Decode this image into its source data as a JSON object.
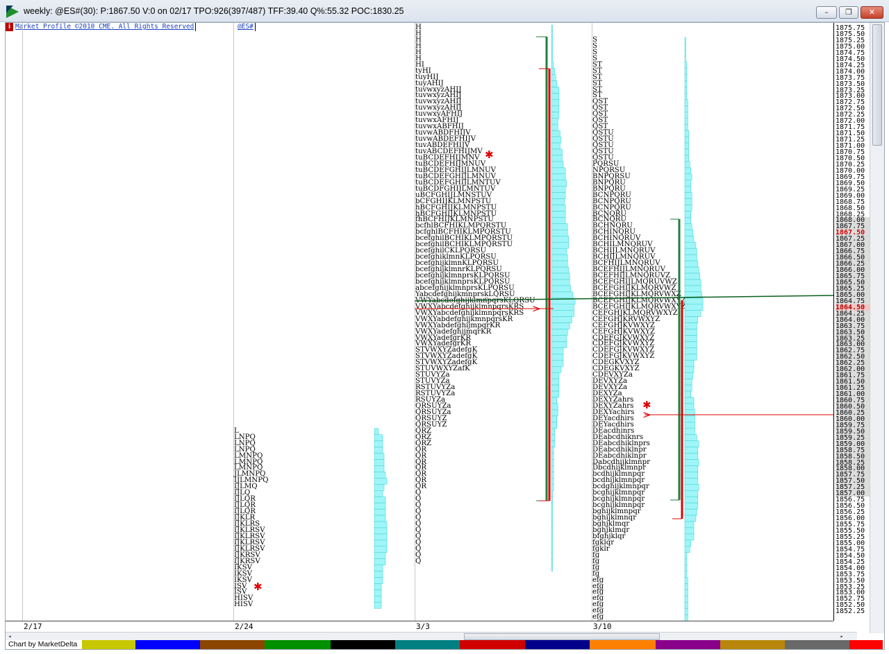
{
  "window": {
    "title": "weekly: @ES#(30): P:1867.50 V:0 on 02/17 TPO:926(397/487) TFF:39.40 Q%:55.32 POC:1830.25",
    "minimize": "–",
    "restore": "❐",
    "close": "✕"
  },
  "chart": {
    "copyright": "Market Profile ©2010 CME. All Rights Reserved",
    "symbol": "@ES#",
    "info_badge": "i",
    "m_badge": "M",
    "credit": "Chart by MarketDelta"
  },
  "dates": [
    "2/17",
    "2/24",
    "3/3",
    "3/10"
  ],
  "colors": {
    "hist": "#9ff5f7",
    "hist_stroke": "#3fd0d4",
    "value_green": "#1e7f3e",
    "value_red": "#e00000",
    "poc_line": "#0b5e1e"
  },
  "prices": [
    "1875.75",
    "1875.50",
    "1875.25",
    "1875.00",
    "1874.75",
    "1874.50",
    "1874.25",
    "1874.00",
    "1873.75",
    "1873.50",
    "1873.25",
    "1873.00",
    "1872.75",
    "1872.50",
    "1872.25",
    "1872.00",
    "1871.75",
    "1871.50",
    "1871.25",
    "1871.00",
    "1870.75",
    "1870.50",
    "1870.25",
    "1870.00",
    "1869.75",
    "1869.50",
    "1869.25",
    "1869.00",
    "1868.75",
    "1868.50",
    "1868.25",
    "1868.00",
    "1867.75",
    "1867.50",
    "1867.25",
    "1867.00",
    "1866.75",
    "1866.50",
    "1866.25",
    "1866.00",
    "1865.75",
    "1865.50",
    "1865.25",
    "1865.00",
    "1864.75",
    "1864.50",
    "1864.25",
    "1864.00",
    "1863.75",
    "1863.50",
    "1863.25",
    "1863.00",
    "1862.75",
    "1862.50",
    "1862.25",
    "1862.00",
    "1861.75",
    "1861.50",
    "1861.25",
    "1861.00",
    "1860.75",
    "1860.50",
    "1860.25",
    "1860.00",
    "1859.75",
    "1859.50",
    "1859.25",
    "1859.00",
    "1858.75",
    "1858.50",
    "1858.25",
    "1858.00",
    "1857.75",
    "1857.50",
    "1857.25",
    "1857.00",
    "1856.75",
    "1856.50",
    "1856.25",
    "1856.00",
    "1855.75",
    "1855.50",
    "1855.25",
    "1855.00",
    "1854.75",
    "1854.50",
    "1854.25",
    "1854.00",
    "1853.75",
    "1853.50",
    "1853.25",
    "1853.00",
    "1852.75",
    "1852.50",
    "1852.25"
  ],
  "profile_2_24": [
    "L",
    "LNPQ",
    "LNPQ",
    "LNPQ",
    "LMNPQ",
    "LMNPQ",
    "LMNPQ",
    "JLMNPQ",
    "IJLMNPQ",
    "IJLMQ",
    "IJLQ",
    "IJLQR",
    "IJLQR",
    "IJLQR",
    "IJKLR",
    "IJKLRS",
    "IJKLRSV",
    "IJKLRSV",
    "IJKLRSV",
    "IJKLRSV",
    "IJKRSV",
    "IJKRSV",
    "IKSV",
    "IKSV",
    "IKSV",
    "ISV",
    "ISV",
    "HISV",
    "HISV"
  ],
  "profile_3_3": [
    "H",
    "H",
    "H",
    "H",
    "H",
    "H",
    "HI",
    "tyHI",
    "tuyHIJ",
    "tuyAHIJ",
    "tuvwxyzAHIJ",
    "tuvwxyzAHIJ",
    "tuvwxyzAHIJ",
    "tuvwxyzAHIJ",
    "tuvwxyAFHIJ",
    "tuvwxAFHIJ",
    "tuvwxABFHIJ",
    "tuvwABDFHIJV",
    "tuvwABDEFHIJV",
    "tuvABDEFHIJV",
    "tuvABCDEFHIJMV",
    "tuBCDEFHIJMNV",
    "tuBCDEFHIJMNUV",
    "tuBCDEFGHIJLMNUV",
    "tuBCDEFGHIJLMNUV",
    "tuBCDEFGHIJLMNTUV",
    "tuBCDFGHIJLMNTUV",
    "uBCFGHIJLMNSTUV",
    "bCFGHIJKLMNPSTU",
    "hBCFGHIJKLMNPSTU",
    "hBCFGHIJKLMNPSTU",
    "fhBCFHIJKLMNPSTU",
    "bcfhlBCFHIKLMPQRSTU",
    "bcfghlBCFHIKLMPQRSTU",
    "bcefghilBCHIKLMPQRSTU",
    "bcefghilBCHIKLMPQRSTU",
    "bcefghilCKLPQRSU",
    "bcefghiklmnKLPQRSU",
    "bcefghijklmnKLPQRSU",
    "bcefghijklmnrKLPQRSU",
    "bcefghijklmnprsKLPQRSU",
    "bcefghijklmnprsKLPQRSU",
    "abcefghijklmnprsKLPQRSU",
    "Yabcdefghijkmnprsk̲LQRSU",
    "VWYabcdefghijklmnpqrsKLQRSU",
    "VWXYabcdefghijklmnpqrsKRS",
    "VWXYabcdefghijklmnpqrsKRS",
    "VWXYabdefghijkmnpqrsKR",
    "VWXYabdefghijmpqrKR",
    "VWXYadefghijmqrKR",
    "VWXYadefgrKR",
    "VWXYadefgrKR",
    "STVWXYZadefgK",
    "STVWXYZadefgK",
    "STVWXYZadefgK",
    "STUVWXYZafK",
    "STUVYZa",
    "STUVYZa",
    "RSTUVYZa",
    "RSTUVYZa",
    "RSUYZa",
    "QRSUYZa",
    "QRSUYZa",
    "QRSUYZ",
    "QRSUYZ",
    "QRZ",
    "QRZ",
    "QRZ",
    "QR",
    "QR",
    "QR",
    "QR",
    "QR",
    "QR",
    "QR",
    "Q",
    "Q",
    "Q",
    "Q",
    "Q",
    "Q",
    "Q",
    "Q",
    "Q",
    "Q",
    "Q",
    "Q"
  ],
  "profile_3_10": [
    "S",
    "S",
    "S",
    "S",
    "ST",
    "ST",
    "ST",
    "ST",
    "ST",
    "ST",
    "QST",
    "QST",
    "QST",
    "QST",
    "QST",
    "QSTU",
    "QSTU",
    "QSTU",
    "QSTU",
    "QSTU",
    "PQRSU",
    "NPQRSU",
    "BNPQRSU",
    "BNPQRU",
    "BNPQRU",
    "BCNPQRU",
    "BCNPQRU",
    "BCNPQRU",
    "BCNQRU",
    "BCNQRU",
    "BCHNQRU",
    "BCHINQRU",
    "BCHINQRUV",
    "BCHILMNQRUV",
    "BCHIJLMNQRUV",
    "BCHIJLMNQRUV",
    "BCFHIJLMNQRUV",
    "BCEFHIJLMNQRUV",
    "BCEFHIJLMNQRUVZ",
    "BCEFGHIJLMQRUVWZ",
    "BCEFGHIJKLMQRVWZ",
    "BCEFGHIJKLMQRVWXZ",
    "BCEFGHIJKLMQRVWXYZ",
    "BCEFGHIJKLMQRVWXYZ",
    "CEFGHJKLMQRVWXYZ",
    "CEFGHJKRVWXYZ",
    "CEFGHJKVWXYZ",
    "CEFGHJKVWXYZ",
    "CDEFGJKVWXYZ",
    "CDEFGJKVWXYZ",
    "CDEFGJKVWXYZ",
    "CDEFGJKVWXYZ",
    "CDEGKVXYZ",
    "CDEGKVXYZ",
    "CDEVXYZa",
    "DEVXYZa",
    "DEVXYZa",
    "DEXYZa",
    "DEXYZahrs",
    "DEXYZahrs",
    "DEXYachirs",
    "DEYacdhirs",
    "DEYacdhirs",
    "DEacdhinrs",
    "DEabcdhiknrs",
    "DEabcdhiklnprs",
    "DEabcdhiklnpr",
    "DEabcdhiklnpr",
    "Dabcdhijklmnpr",
    "Dbcdhijklmnpr",
    "bcdhijklmnpqr",
    "bcdhijklmnpqr",
    "bcdghijklmnpqr",
    "bcghijklmnpqr",
    "bcghijklmnpqr",
    "bcghijklmnpqr",
    "bghijklmnpqr",
    "bghijklmnqr",
    "bghjklmqr",
    "bghjklmqr",
    "bfghjklqr",
    "fgklqr",
    "fgklr",
    "fg",
    "fg",
    "fg",
    "fg",
    "efg",
    "efg",
    "efg",
    "efg",
    "efg",
    "efg",
    "efg",
    "efg",
    "efg",
    "efg",
    "efg",
    "efg"
  ],
  "hist_2_24": [
    3,
    6,
    6,
    6,
    7,
    7,
    7,
    8,
    9,
    7,
    6,
    8,
    8,
    8,
    8,
    9,
    9,
    9,
    9,
    9,
    8,
    8,
    6,
    6,
    6,
    5,
    5,
    5,
    5
  ],
  "hist_3_3": [
    1,
    1,
    1,
    1,
    1,
    1,
    2,
    3,
    4,
    5,
    7,
    7,
    7,
    7,
    7,
    6,
    6,
    8,
    9,
    8,
    10,
    10,
    11,
    13,
    13,
    14,
    13,
    13,
    12,
    13,
    13,
    13,
    15,
    15,
    16,
    16,
    14,
    15,
    15,
    16,
    17,
    17,
    18,
    20,
    22,
    21,
    21,
    19,
    17,
    15,
    14,
    14,
    11,
    11,
    11,
    9,
    7,
    7,
    7,
    7,
    5,
    6,
    6,
    5,
    5,
    3,
    3,
    3,
    2,
    2,
    2,
    2,
    2,
    2,
    2,
    1,
    1,
    1,
    1,
    1,
    1,
    1,
    1,
    1,
    1,
    1,
    1,
    1
  ],
  "hist_3_10": [
    1,
    1,
    1,
    1,
    2,
    2,
    2,
    2,
    2,
    2,
    3,
    3,
    3,
    3,
    3,
    4,
    4,
    4,
    4,
    4,
    5,
    6,
    7,
    6,
    6,
    7,
    7,
    7,
    6,
    6,
    7,
    8,
    9,
    11,
    12,
    12,
    13,
    14,
    15,
    16,
    16,
    17,
    18,
    18,
    16,
    13,
    12,
    12,
    12,
    12,
    12,
    12,
    9,
    9,
    8,
    7,
    7,
    6,
    9,
    9,
    10,
    10,
    10,
    10,
    12,
    14,
    13,
    13,
    14,
    13,
    13,
    13,
    14,
    13,
    13,
    13,
    12,
    11,
    9,
    9,
    9,
    6,
    5,
    2,
    2,
    2,
    2,
    3,
    3,
    3,
    3,
    3,
    3,
    3,
    3,
    3,
    3,
    3,
    3
  ]
}
